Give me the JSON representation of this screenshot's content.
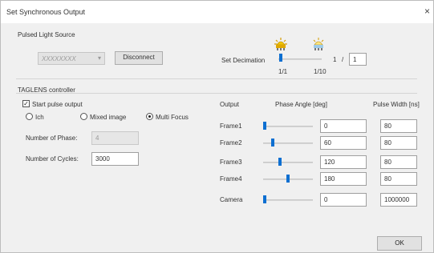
{
  "window": {
    "title": "Set Synchronous Output",
    "close_glyph": "×"
  },
  "pulsed_light": {
    "group_label": "Pulsed Light Source",
    "device_value": "XXXXXXXX",
    "disconnect_label": "Disconnect"
  },
  "decimation": {
    "label": "Set Decimation",
    "left_value": "1",
    "separator": "/",
    "right_value": "1",
    "tick_left": "1/1",
    "tick_right": "1/10"
  },
  "taglens": {
    "group_label": "TAGLENS controller",
    "start_pulse_label": "Start pulse output",
    "modes": [
      {
        "label": "Ich",
        "selected": false
      },
      {
        "label": "Mixed image",
        "selected": false
      },
      {
        "label": "Multi Focus",
        "selected": true
      }
    ],
    "num_phase_label": "Number of Phase:",
    "num_phase_value": "4",
    "num_cycles_label": "Number of Cycles:",
    "num_cycles_value": "3000"
  },
  "output": {
    "col_output": "Output",
    "col_phase": "Phase Angle [deg]",
    "col_pulse": "Pulse Width [ns]",
    "rows": [
      {
        "label": "Frame1",
        "phase": "0",
        "pulse": "80",
        "slider": 0.0
      },
      {
        "label": "Frame2",
        "phase": "60",
        "pulse": "80",
        "slider": 0.17
      },
      {
        "label": "Frame3",
        "phase": "120",
        "pulse": "80",
        "slider": 0.33
      },
      {
        "label": "Frame4",
        "phase": "180",
        "pulse": "80",
        "slider": 0.5
      },
      {
        "label": "Camera",
        "phase": "0",
        "pulse": "1000000",
        "slider": 0.0
      }
    ]
  },
  "footer": {
    "ok_label": "OK"
  }
}
